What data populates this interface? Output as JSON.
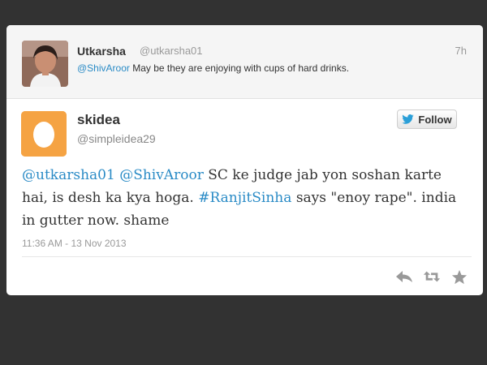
{
  "reply_tweet": {
    "name": "Utkarsha",
    "handle": "@utkarsha01",
    "time": "7h",
    "mention": "@ShivAroor",
    "text": "May be they are enjoying with cups of hard drinks."
  },
  "main_tweet": {
    "name": "skidea",
    "handle": "@simpleidea29",
    "follow_label": "Follow",
    "mention1": "@utkarsha01",
    "mention2": "@ShivAroor",
    "text_part1": "SC ke judge jab yon soshan karte hai, is desh ka kya hoga.",
    "hashtag": "#RanjitSinha",
    "text_part2": "says \"enoy rape\". india in gutter now. shame",
    "timestamp": "11:36 AM - 13 Nov 2013"
  },
  "icons": {
    "reply": "reply-icon",
    "retweet": "retweet-icon",
    "favorite": "favorite-icon",
    "follow": "twitter-bird-icon"
  },
  "colors": {
    "link": "#2a8bc6",
    "avatar_bg": "#f5a343"
  }
}
